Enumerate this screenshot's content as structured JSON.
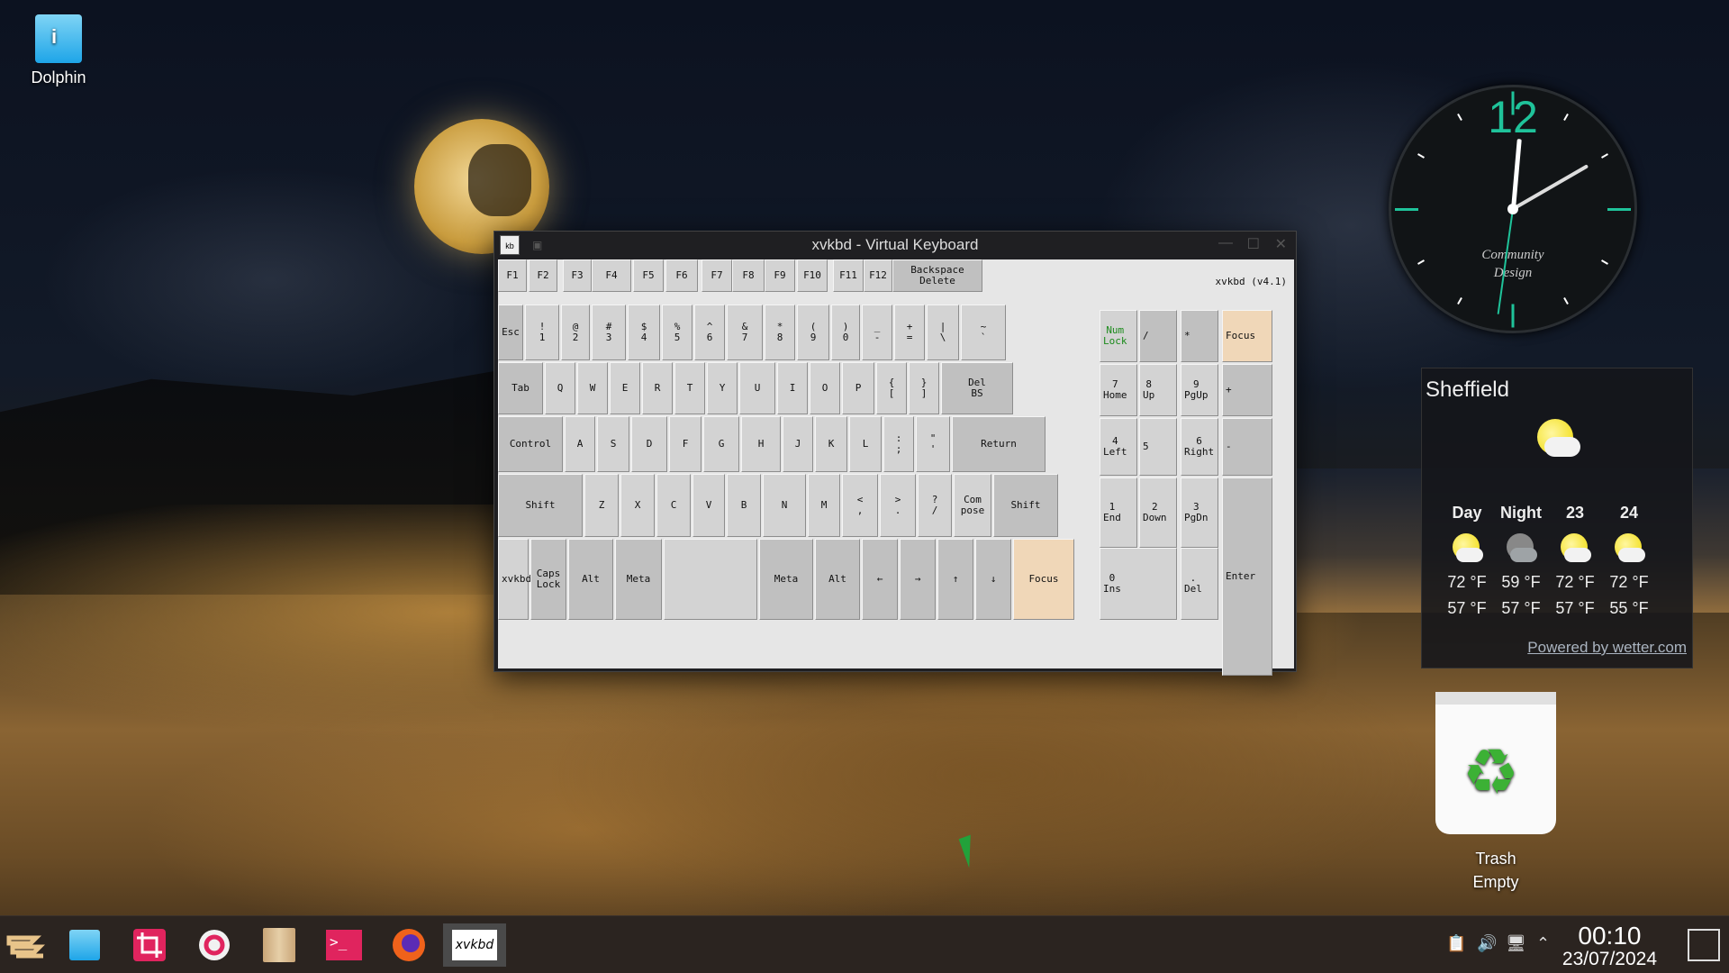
{
  "desktop": {
    "icons": [
      {
        "label": "Dolphin",
        "icon": "dolphin-folder-icon"
      }
    ],
    "trash": {
      "label": "Trash",
      "status": "Empty",
      "icon": "trash-recycle-icon"
    }
  },
  "window": {
    "title": "xvkbd - Virtual Keyboard",
    "version": "xvkbd (v4.1)",
    "function_row": [
      "F1",
      "F2",
      "F3",
      "F4",
      "F5",
      "F6",
      "F7",
      "F8",
      "F9",
      "F10",
      "F11",
      "F12",
      "Backspace\nDelete"
    ],
    "number_row": [
      "Esc",
      "!\n1",
      "@\n2",
      "#\n3",
      "$\n4",
      "%\n5",
      "^\n6",
      "&\n7",
      "*\n8",
      "(\n9",
      ")\n0",
      "_\n-",
      "+\n=",
      "|\n\\",
      "~\n`"
    ],
    "top_row": [
      "Tab",
      "Q",
      "W",
      "E",
      "R",
      "T",
      "Y",
      "U",
      "I",
      "O",
      "P",
      "{\n[",
      "}\n]",
      "Del\nBS"
    ],
    "home_row": [
      "Control",
      "A",
      "S",
      "D",
      "F",
      "G",
      "H",
      "J",
      "K",
      "L",
      ":\n;",
      "\"\n'",
      "Return"
    ],
    "shift_row": [
      "Shift",
      "Z",
      "X",
      "C",
      "V",
      "B",
      "N",
      "M",
      "<\n,",
      ">\n.",
      "?\n/",
      "Com\npose",
      "Shift"
    ],
    "bottom_row": [
      "xvkbd",
      "Caps\nLock",
      "Alt",
      "Meta",
      "",
      "Meta",
      "Alt",
      "←",
      "→",
      "↑",
      "↓",
      "Focus"
    ],
    "numpad": [
      "Num\nLock",
      "/",
      "*",
      "Focus",
      "7\nHome",
      "8\nUp",
      "9\nPgUp",
      "+",
      "4\nLeft",
      "5",
      "6\nRight",
      "-",
      "1\nEnd",
      "2\nDown",
      "3\nPgDn",
      "Enter",
      "0\nIns",
      ".\nDel"
    ]
  },
  "clock": {
    "number": "12",
    "brand": "Community\nDesign",
    "time_display": "00:10"
  },
  "weather": {
    "city": "Sheffield",
    "columns": [
      {
        "label": "Day",
        "icon": "sun-cloud-icon",
        "high": "72 °F",
        "low": "57 °F"
      },
      {
        "label": "Night",
        "icon": "moon-cloud-icon",
        "high": "59 °F",
        "low": "57 °F"
      },
      {
        "label": "23",
        "icon": "sun-cloud-icon",
        "high": "72 °F",
        "low": "57 °F"
      },
      {
        "label": "24",
        "icon": "sun-cloud-icon",
        "high": "72 °F",
        "low": "55 °F"
      }
    ],
    "powered": "Powered by wetter.com"
  },
  "taskbar": {
    "apps": [
      {
        "name": "application-launcher-icon",
        "label": ""
      },
      {
        "name": "dolphin-icon",
        "label": ""
      },
      {
        "name": "spectacle-crop-icon",
        "label": ""
      },
      {
        "name": "settings-icon",
        "label": ""
      },
      {
        "name": "archive-icon",
        "label": ""
      },
      {
        "name": "terminal-icon",
        "label": ""
      },
      {
        "name": "firefox-icon",
        "label": ""
      },
      {
        "name": "xvkbd-icon",
        "label": "xvkbd"
      }
    ],
    "time": "00:10",
    "date": "23/07/2024"
  },
  "colors": {
    "accent": "#1fc39a",
    "focus_key": "#f0d7b8",
    "taskbar": "#2b2420"
  }
}
